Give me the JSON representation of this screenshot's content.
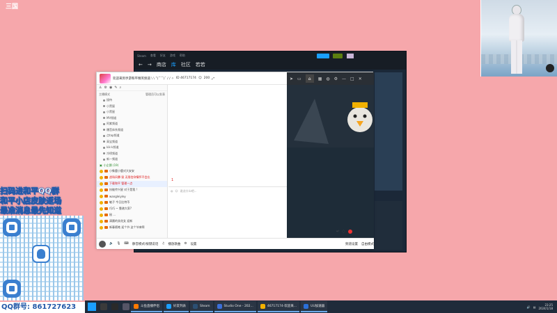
{
  "logo": {
    "big": "三国",
    "small": ""
  },
  "steam": {
    "title_menu": [
      "Steam",
      "查看",
      "好友",
      "游戏",
      "帮助"
    ],
    "nav": [
      "商店",
      "库",
      "社区",
      "若若"
    ],
    "active_nav_index": 1
  },
  "yy": {
    "channel_title": "欢迎来到手游和平精英频道 \\ \\ ˚(ˆ ̄ˆ ̄)ˆ / / ✧",
    "channel_id": "ID 46717174",
    "online_count": "200",
    "sort_label": "主播模式",
    "manage_label": "管理员可以发表",
    "groups": [
      "接待",
      "小黑屋",
      "小黑屋",
      "MV频道",
      "阿紫频道",
      "爆音体系频道",
      "点tap频道",
      "高宝频道",
      "kik-k频道",
      "冷榜频道",
      "新一频道"
    ],
    "subchannel": "小企鹅 (19)",
    "users": [
      {
        "name": "小象鹿小鹿对大安安",
        "sel": false
      },
      {
        "name": "战场风暴·鼠 无限信仰情怀不会忘",
        "sel": false
      },
      {
        "name": "下载和平 管理一点",
        "sel": true
      },
      {
        "name": "技能传兴星 对于是我 !",
        "sel": false
      },
      {
        "name": "wangleiyley",
        "sel": false
      },
      {
        "name": "敏子 今日比特币",
        "sel": false
      },
      {
        "name": "巧巧 ~ 靠谱大家?",
        "sel": false
      },
      {
        "name": "秘 ...",
        "sel": false
      },
      {
        "name": "清晨的卖花女 迎新",
        "sel": false
      },
      {
        "name": "新春随笔 迎个节 这个节来啊",
        "sel": false
      }
    ],
    "input_placeholder": "说点什么吧...",
    "message_counter": "1",
    "bottom": {
      "switch_mode": "静音模式/按键说话",
      "music": "播放歌曲",
      "settings": "设置",
      "channel_settings": "频道设置",
      "mode": "自由模式"
    }
  },
  "promo": {
    "lines": [
      "扫码进和平QQ群",
      "和平小店皮肤返场",
      "最准消息最先知道"
    ],
    "qq_label": "QQ群号: 861727623"
  },
  "taskbar": {
    "items": [
      {
        "label": "斗鱼直播伴侣",
        "color": "#ff7a00"
      },
      {
        "label": "好友列表",
        "color": "#1a9fff"
      },
      {
        "label": "Steam",
        "color": "#2c4f73"
      },
      {
        "label": "Studio One - 202...",
        "color": "#3b6fd8"
      },
      {
        "label": "46717174-欢迎来...",
        "color": "#f2b100"
      },
      {
        "label": "UU加速器",
        "color": "#2a6fd8"
      }
    ],
    "time": "23:25",
    "date": "2024/1/18"
  }
}
